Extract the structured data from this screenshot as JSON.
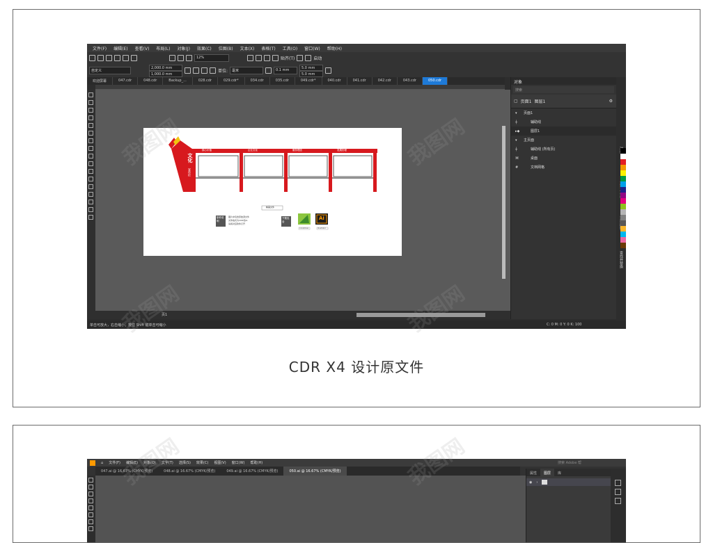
{
  "caption": "CDR X4 设计原文件",
  "watermark": "我图网",
  "cdr": {
    "menu": [
      "文件(F)",
      "编辑(E)",
      "查看(V)",
      "布局(L)",
      "对象(J)",
      "效果(C)",
      "位图(B)",
      "文本(X)",
      "表格(T)",
      "工具(O)",
      "窗口(W)",
      "帮助(H)"
    ],
    "toolbar1": {
      "zoom": "12%",
      "snap_label": "贴齐(T)",
      "launch_label": "启动"
    },
    "toolbar2": {
      "preset": "自定义",
      "width": "2,000.0 mm",
      "height": "1,000.0 mm",
      "unit_label": "单位:",
      "unit": "毫米",
      "nudge": "0.1 mm",
      "dup_x": "5.0 mm",
      "dup_y": "5.0 mm"
    },
    "tabs": [
      "欢迎屏幕",
      "047.cdr",
      "048.cdr",
      "Backup_...",
      "028.cdr",
      "029.cdr*",
      "034.cdr",
      "035.cdr",
      "049.cdr*",
      "040.cdr",
      "041.cdr",
      "042.cdr",
      "043.cdr",
      "050.cdr"
    ],
    "active_tab_index": 13,
    "page_tab": "页1",
    "status": "单击可放大，右击缩小；按住 Shift 键单击可缩小",
    "color_status": "C: 0 M: 0 Y: 0 K: 100",
    "objects_panel": {
      "title": "对象",
      "search": "搜索",
      "page_label": "页面1",
      "layer_label": "图层1",
      "rows": [
        {
          "label": "页面1",
          "level": 0
        },
        {
          "label": "辅助线",
          "level": 1
        },
        {
          "label": "图层1",
          "level": 1
        },
        {
          "label": "主页面",
          "level": 0
        },
        {
          "label": "辅助线 (所有页)",
          "level": 1
        },
        {
          "label": "桌面",
          "level": 1
        },
        {
          "label": "文档网格",
          "level": 1
        }
      ]
    },
    "side_tabs": [
      "对象",
      "对齐与分布",
      "对象属性",
      "查找并替换"
    ],
    "palette": [
      "#000000",
      "#ffffff",
      "#e31e24",
      "#f39800",
      "#fff100",
      "#009944",
      "#00a0e9",
      "#1d2088",
      "#920783",
      "#e4007f",
      "#8fc31f",
      "#b5b5b5",
      "#808080",
      "#595757",
      "#f8b62d",
      "#00b7ee",
      "#ea68a2",
      "#6a3906"
    ],
    "design": {
      "brand_title": "文化",
      "brand_sub": "宣传栏",
      "panel_headers": [
        "核心价值",
        "企业文化",
        "服务理念",
        "发展历程"
      ],
      "info_button": "制作说明",
      "download_button": "下载包含",
      "notes": [
        "图片中包含原始源文件",
        "文件格式为CDR和AI",
        "请用对应软件打开"
      ],
      "center_label": "精美文件",
      "ai_badge": "Ai",
      "format_labels": [
        "CorelDraw",
        "Illustrator"
      ]
    }
  },
  "ai": {
    "menu": [
      "文件(F)",
      "编辑(E)",
      "对象(O)",
      "文字(T)",
      "选择(S)",
      "效果(C)",
      "视图(V)",
      "窗口(W)",
      "帮助(H)"
    ],
    "tabs": [
      "047.ai @ 16.67% (CMYK/预览)",
      "048.ai @ 16.67% (CMYK/预览)",
      "049.ai @ 16.67% (CMYK/预览)",
      "050.ai @ 16.67% (CMYK/预览)"
    ],
    "active_tab_index": 3,
    "panel_tabs": [
      "属性",
      "图层",
      "库"
    ],
    "active_panel_tab_index": 1,
    "search": "搜索 Adobe 帮"
  },
  "colors": {
    "brand_red": "#d7191e",
    "active_tab": "#1e7ad8"
  }
}
